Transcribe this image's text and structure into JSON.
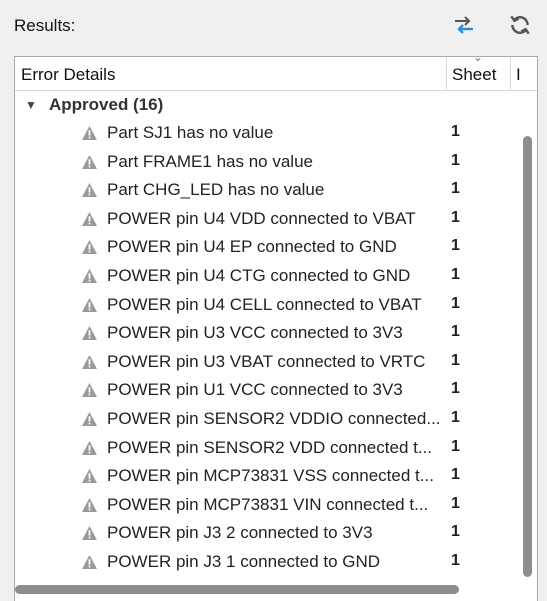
{
  "toolbar": {
    "title": "Results:",
    "switch_icon": "swap-arrows-icon",
    "refresh_icon": "refresh-icon"
  },
  "columns": {
    "details": "Error Details",
    "sheet": "Sheet",
    "extra": "I"
  },
  "group": {
    "label": "Approved (16)",
    "expanded": true
  },
  "colors": {
    "warning_icon": "#9a9a9a",
    "switch_arrow_dark": "#555555",
    "switch_arrow_blue": "#2e8bd6",
    "scrollbar": "#8e8e8e"
  },
  "rows": [
    {
      "message": "Part SJ1 has no value",
      "sheet": "1"
    },
    {
      "message": "Part FRAME1 has no value",
      "sheet": "1"
    },
    {
      "message": "Part CHG_LED has no value",
      "sheet": "1"
    },
    {
      "message": "POWER pin U4 VDD connected to VBAT",
      "sheet": "1"
    },
    {
      "message": "POWER pin U4 EP connected to GND",
      "sheet": "1"
    },
    {
      "message": "POWER pin U4 CTG connected to GND",
      "sheet": "1"
    },
    {
      "message": "POWER pin U4 CELL connected to VBAT",
      "sheet": "1"
    },
    {
      "message": "POWER pin U3 VCC connected to 3V3",
      "sheet": "1"
    },
    {
      "message": "POWER pin U3 VBAT connected to VRTC",
      "sheet": "1"
    },
    {
      "message": "POWER pin U1 VCC connected to 3V3",
      "sheet": "1"
    },
    {
      "message": "POWER pin SENSOR2 VDDIO connected...",
      "sheet": "1"
    },
    {
      "message": "POWER pin SENSOR2 VDD connected t...",
      "sheet": "1"
    },
    {
      "message": "POWER pin MCP73831 VSS connected t...",
      "sheet": "1"
    },
    {
      "message": "POWER pin MCP73831 VIN connected t...",
      "sheet": "1"
    },
    {
      "message": "POWER pin J3 2 connected to 3V3",
      "sheet": "1"
    },
    {
      "message": "POWER pin J3 1 connected to GND",
      "sheet": "1"
    }
  ]
}
